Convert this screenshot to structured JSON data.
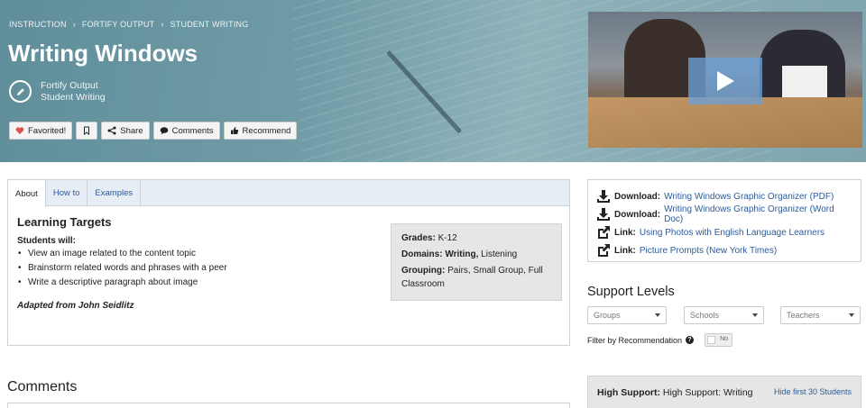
{
  "breadcrumb": [
    "INSTRUCTION",
    "FORTIFY OUTPUT",
    "STUDENT WRITING"
  ],
  "page": {
    "title": "Writing Windows",
    "subtitle_1": "Fortify Output",
    "subtitle_2": "Student Writing"
  },
  "actions": {
    "favorited": "Favorited!",
    "share": "Share",
    "comments": "Comments",
    "recommend": "Recommend"
  },
  "tabs": [
    "About",
    "How to",
    "Examples"
  ],
  "about": {
    "heading": "Learning Targets",
    "students_will": "Students will:",
    "targets": [
      "View an image related to the content topic",
      "Brainstorm related words and phrases with a peer",
      "Write a descriptive paragraph about image"
    ],
    "attribution": "Adapted from John Seidlitz"
  },
  "meta": {
    "grades_label": "Grades:",
    "grades_value": "K-12",
    "domains_label": "Domains:",
    "domains_bold": "Writing,",
    "domains_rest": "Listening",
    "grouping_label": "Grouping:",
    "grouping_value": "Pairs, Small Group, Full Classroom"
  },
  "comments_heading": "Comments",
  "resources": [
    {
      "icon": "download-icon",
      "kind": "Download:",
      "text": "Writing Windows Graphic Organizer (PDF)"
    },
    {
      "icon": "download-icon",
      "kind": "Download:",
      "text": "Writing Windows Graphic Organizer (Word Doc)"
    },
    {
      "icon": "external-link-icon",
      "kind": "Link:",
      "text": "Using Photos with English Language Learners"
    },
    {
      "icon": "external-link-icon",
      "kind": "Link:",
      "text": "Picture Prompts (New York Times)"
    }
  ],
  "support": {
    "heading": "Support Levels",
    "filters": [
      "Groups",
      "Schools",
      "Teachers"
    ],
    "filter_label": "Filter by Recommendation",
    "toggle_text": "No",
    "high_support_label": "High Support:",
    "high_support_value": "High Support: Writing",
    "hide_link": "Hide first 30 Students"
  },
  "colors": {
    "link": "#2d5c9a",
    "favorite_heart": "#d9534f",
    "play_button": "#6ca0d6"
  }
}
